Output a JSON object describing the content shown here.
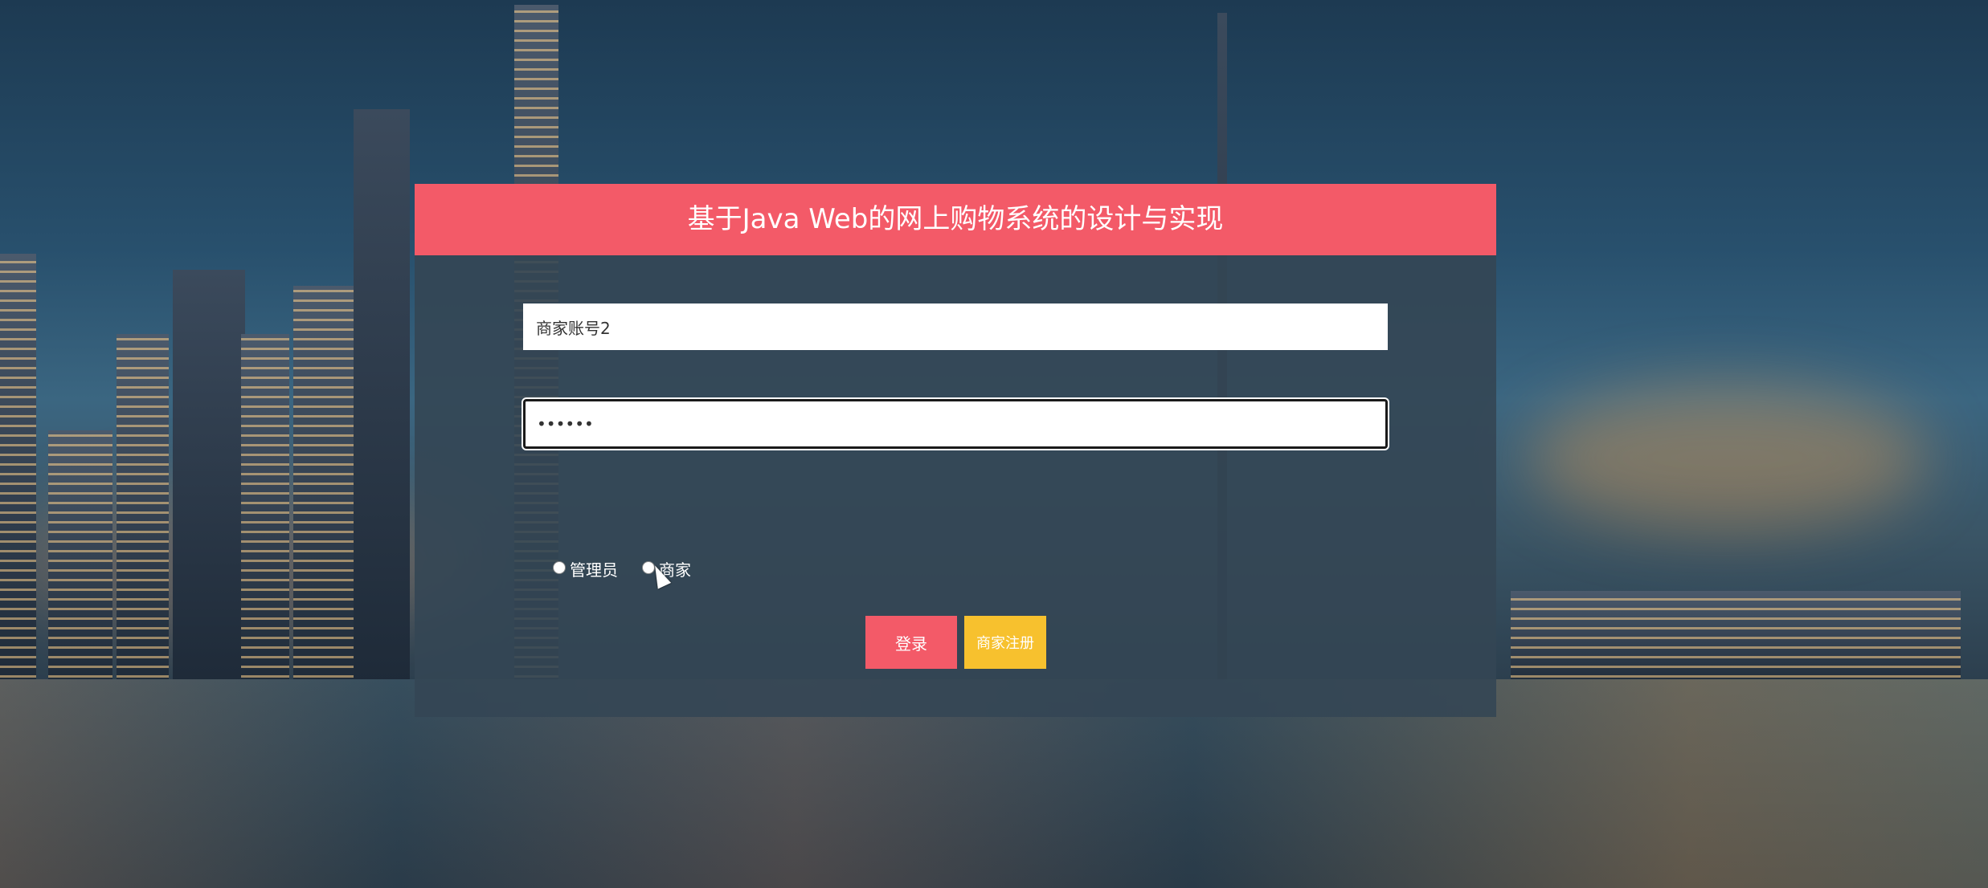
{
  "panel": {
    "title": "基于Java Web的网上购物系统的设计与实现"
  },
  "form": {
    "username_value": "商家账号2",
    "password_value": "123456"
  },
  "roles": [
    {
      "label": "管理员",
      "checked": false
    },
    {
      "label": "商家",
      "checked": false
    }
  ],
  "buttons": {
    "login_label": "登录",
    "register_label": "商家注册"
  },
  "colors": {
    "header": "#f35a68",
    "login": "#f35a68",
    "register": "#f7c12e"
  }
}
